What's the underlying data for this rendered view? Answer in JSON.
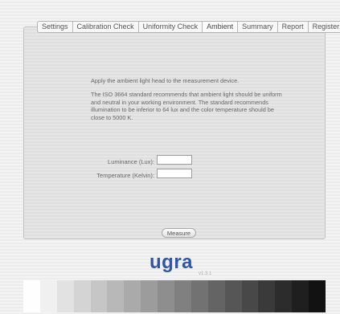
{
  "tabs": [
    "Settings",
    "Calibration Check",
    "Uniformity Check",
    "Ambient",
    "Summary",
    "Report",
    "Register"
  ],
  "active_tab": "Ambient",
  "instructions": {
    "p1": "Apply the ambient light head to the measurement device.",
    "p2": "The ISO 3664 standard recommends that ambient light should be uniform and neutral in your working environment. The standard recommends illumination to be inferior to 64 lux and the color temperature should be close to 5000 K."
  },
  "form": {
    "luminance_label": "Luminance (Lux):",
    "luminance_value": "",
    "temperature_label": "Temperature (Kelvin):",
    "temperature_value": ""
  },
  "buttons": {
    "measure": "Measure"
  },
  "branding": {
    "logo": "ugra",
    "version": "v1.3.1"
  },
  "gray_strip": [
    "#fefefe",
    "#f0f0f0",
    "#e2e2e2",
    "#d4d4d4",
    "#c6c6c6",
    "#b8b8b8",
    "#aaaaaa",
    "#9c9c9c",
    "#8e8e8e",
    "#808080",
    "#727272",
    "#646464",
    "#565656",
    "#484848",
    "#3a3a3a",
    "#2c2c2c",
    "#1f1f1f",
    "#121212"
  ]
}
